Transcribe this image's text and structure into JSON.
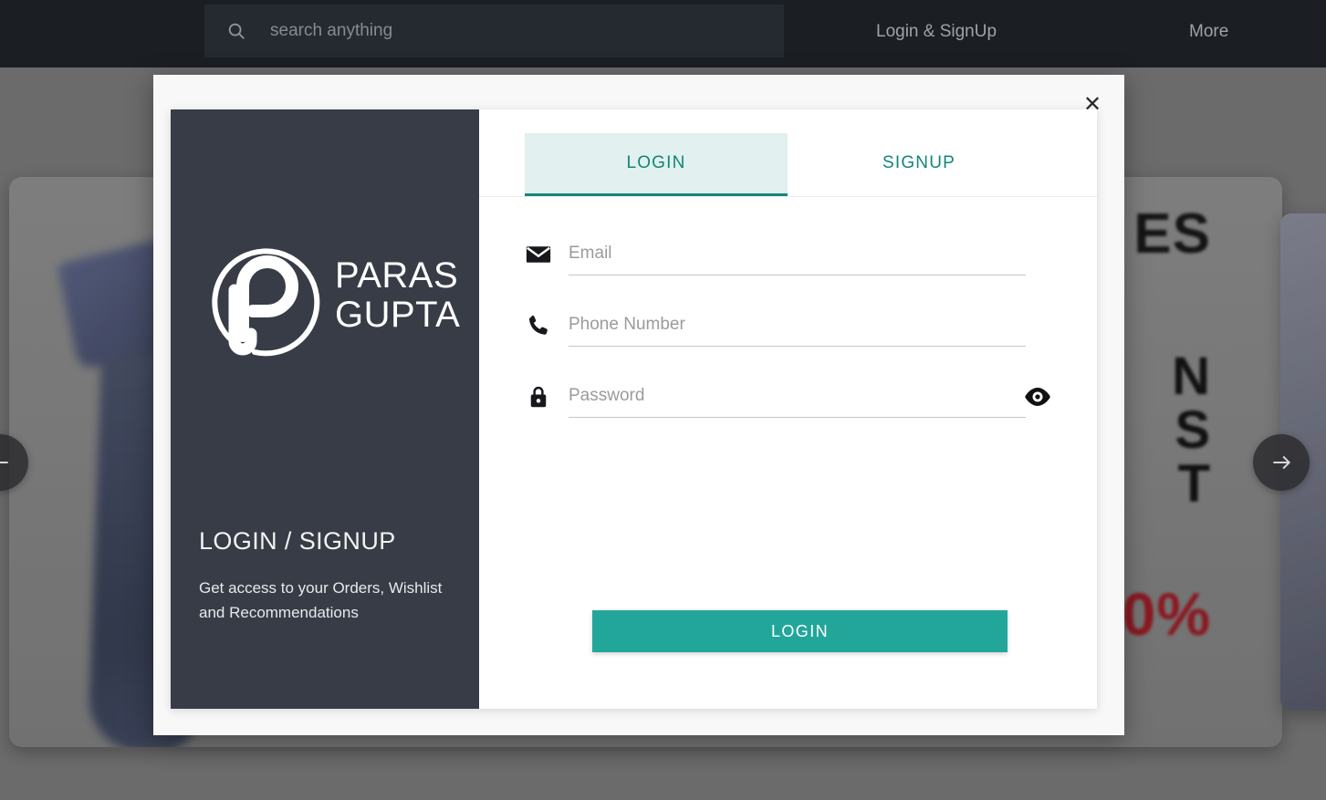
{
  "header": {
    "search": {
      "placeholder": "search anything",
      "value": "",
      "icon": "search-icon"
    },
    "nav": {
      "login_signup": "Login & SignUp",
      "more": "More"
    },
    "background_color": "#191d21"
  },
  "background": {
    "carousel": {
      "prev_label": "←",
      "next_label": "→",
      "banner_line1": "ES",
      "banner_line2": "N\nS\nT",
      "banner_line3": "0%",
      "banner_accent_color": "#a11620"
    }
  },
  "modal": {
    "close_label": "✕",
    "left_panel": {
      "brand_name": "PARAS\nGUPTA",
      "logo_icon": "paras-gupta-p-logo",
      "title": "LOGIN / SIGNUP",
      "subtitle": "Get access to your Orders, Wishlist and Recommendations",
      "background_color": "#373c46"
    },
    "tabs": [
      {
        "label": "LOGIN",
        "active": true
      },
      {
        "label": "SIGNUP",
        "active": false
      }
    ],
    "accent_color": "#22a69a",
    "active_tab_background": "#e2f0ef",
    "form": {
      "fields": [
        {
          "name": "email",
          "icon": "envelope-icon",
          "placeholder": "Email",
          "value": ""
        },
        {
          "name": "phone",
          "icon": "phone-icon",
          "placeholder": "Phone Number",
          "value": ""
        },
        {
          "name": "password",
          "icon": "lock-icon",
          "placeholder": "Password",
          "value": ""
        }
      ],
      "password_toggle_icon": "eye-icon",
      "submit_label": "LOGIN"
    }
  }
}
